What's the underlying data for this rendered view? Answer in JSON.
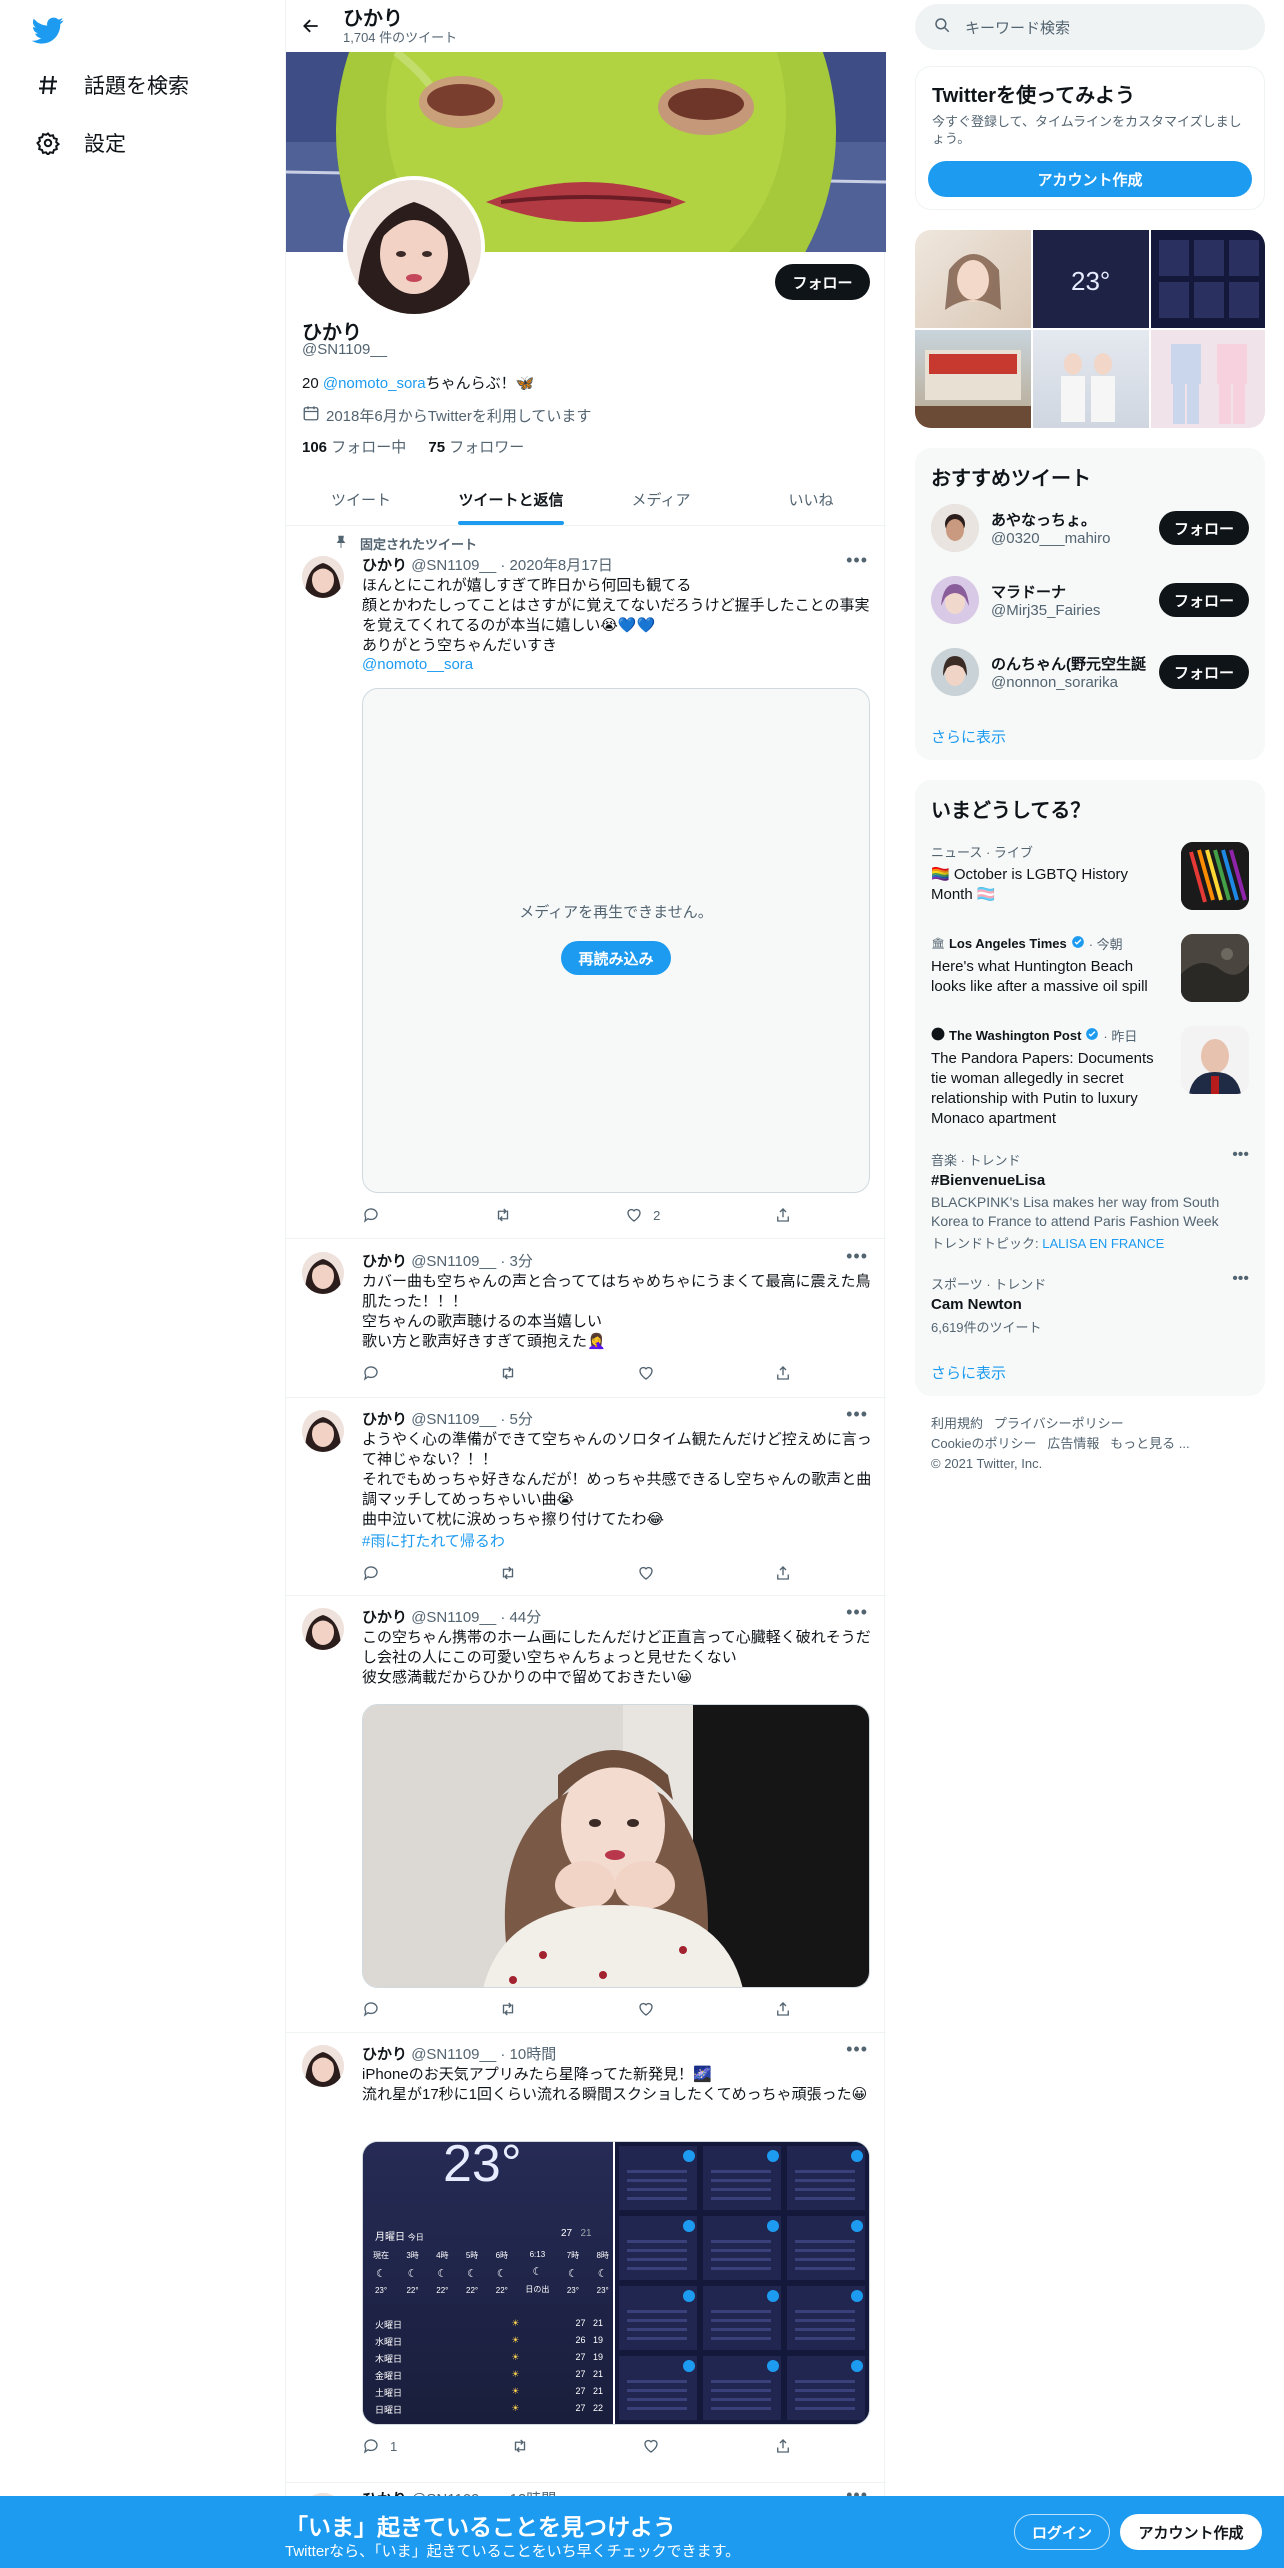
{
  "nav": {
    "explore": "話題を検索",
    "settings": "設定"
  },
  "header": {
    "name": "ひかり",
    "tweet_count": "1,704 件のツイート"
  },
  "profile": {
    "follow_label": "フォロー",
    "name": "ひかり",
    "handle": "@SN1109__",
    "bio_prefix": "20 ",
    "bio_mention": "@nomoto_sora",
    "bio_suffix": "ちゃんらぶ！🦋",
    "joined": "2018年6月からTwitterを利用しています",
    "following_count": "106",
    "following_label": " フォロー中",
    "followers_count": "75",
    "followers_label": " フォロワー"
  },
  "tabs": [
    {
      "label": "ツイート"
    },
    {
      "label": "ツイートと返信"
    },
    {
      "label": "メディア"
    },
    {
      "label": "いいね"
    }
  ],
  "tweets": [
    {
      "pinned_label": "固定されたツイート",
      "name": "ひかり",
      "handle": "@SN1109__",
      "time": "· 2020年8月17日",
      "text": "ほんとにこれが嬉しすぎて昨日から何回も観てる\n顔とかわたしってことはさすがに覚えてないだろうけど握手したことの事実を覚えてくれてるのが本当に嬉しい😭💙💙\nありがとう空ちゃんだいすき",
      "mention": "@nomoto__sora",
      "media_error": "メディアを再生できません。",
      "reload_label": "再読み込み",
      "like_count": "2"
    },
    {
      "name": "ひかり",
      "handle": "@SN1109__",
      "time": "· 3分",
      "text": "カバー曲も空ちゃんの声と合っててはちゃめちゃにうまくて最高に震えた鳥肌たった！！！\n空ちゃんの歌声聴けるの本当嬉しい\n歌い方と歌声好きすぎて頭抱えた🤦‍♀️"
    },
    {
      "name": "ひかり",
      "handle": "@SN1109__",
      "time": "· 5分",
      "text": "ようやく心の準備ができて空ちゃんのソロタイム観たんだけど控えめに言って神じゃない？！！\nそれでもめっちゃ好きなんだが！めっちゃ共感できるし空ちゃんの歌声と曲調マッチしてめっちゃいい曲😭\n曲中泣いて枕に涙めっちゃ擦り付けてたわ😂",
      "hashtag": "#雨に打たれて帰るわ"
    },
    {
      "name": "ひかり",
      "handle": "@SN1109__",
      "time": "· 44分",
      "text": "この空ちゃん携帯のホーム画にしたんだけど正直言って心臓軽く破れそうだし会社の人にこの可愛い空ちゃんちょっと見せたくない\n彼女感満載だからひかりの中で留めておきたい😀"
    },
    {
      "name": "ひかり",
      "handle": "@SN1109__",
      "time": "· 10時間",
      "text": "iPhoneのお天気アプリみたら星降ってた新発見！🌌\n流れ星が17秒に1回くらい流れる瞬間スクショしたくてめっちゃ頑張った😀",
      "reply_count": "1",
      "weather": {
        "temp": "23°",
        "day_label": "月曜日",
        "today_label": "今日",
        "hi": "27",
        "lo": "21",
        "hours": [
          "現在",
          "3時",
          "4時",
          "5時",
          "6時",
          "6:13",
          "7時",
          "8時"
        ],
        "hour_temps": [
          "23°",
          "22°",
          "22°",
          "22°",
          "22°",
          "日の出",
          "23°",
          "23°"
        ],
        "days": [
          {
            "d": "火曜日",
            "hi": "27",
            "lo": "21"
          },
          {
            "d": "水曜日",
            "hi": "26",
            "lo": "19"
          },
          {
            "d": "木曜日",
            "hi": "27",
            "lo": "19"
          },
          {
            "d": "金曜日",
            "hi": "27",
            "lo": "21"
          },
          {
            "d": "土曜日",
            "hi": "27",
            "lo": "21"
          },
          {
            "d": "日曜日",
            "hi": "27",
            "lo": "22"
          }
        ]
      }
    },
    {
      "name": "ひかり",
      "handle": "@SN1109__",
      "time": "· 12時間"
    }
  ],
  "sidebar": {
    "search_placeholder": "キーワード検索",
    "signup_title": "Twitterを使ってみよう",
    "signup_text": "今すぐ登録して、タイムラインをカスタマイズしましょう。",
    "signup_button": "アカウント作成",
    "grid_weather_temp": "23°",
    "rec_title": "おすすめツイート",
    "recommendations": [
      {
        "name": "あやなっちょ。",
        "handle": "@0320___mahiro",
        "follow": "フォロー"
      },
      {
        "name": "マラドーナ",
        "handle": "@Mirj35_Fairies",
        "follow": "フォロー"
      },
      {
        "name": "のんちゃん(野元空生誕",
        "handle": "@nonnon_sorarika",
        "follow": "フォロー"
      }
    ],
    "show_more": "さらに表示",
    "trends_title": "いまどうしてる？",
    "trends": [
      {
        "meta": "ニュース · ライブ",
        "title": "🏳️‍🌈 October is LGBTQ History Month 🏳️‍⚧️"
      },
      {
        "source": "Los Angeles Times",
        "meta": "· 今朝",
        "title": "Here's what Huntington Beach looks like after a massive oil spill"
      },
      {
        "source": "The Washington Post",
        "meta": "· 昨日",
        "title": "The Pandora Papers: Documents tie woman allegedly in secret relationship with Putin to luxury Monaco apartment"
      },
      {
        "meta": "音楽 · トレンド",
        "title": "#BienvenueLisa",
        "desc": "BLACKPINK's Lisa makes her way from South Korea to France to attend Paris Fashion Week",
        "topic_label": "トレンドトピック: ",
        "topic": "LALISA EN FRANCE"
      },
      {
        "meta": "スポーツ · トレンド",
        "title": "Cam Newton",
        "desc": "6,619件のツイート"
      }
    ],
    "trends_more": "さらに表示",
    "footer": {
      "terms": "利用規約",
      "privacy": "プライバシーポリシー",
      "cookies": "Cookieのポリシー",
      "ads": "広告情報",
      "more": "もっと見る ...",
      "copyright": "© 2021 Twitter, Inc."
    }
  },
  "bottom": {
    "title": "「いま」起きていることを見つけよう",
    "subtitle": "Twitterなら、「いま」起きていることをいち早くチェックできます。",
    "login": "ログイン",
    "signup": "アカウント作成"
  },
  "colors": {
    "accent": "#1d9bf0",
    "text": "#0f1419",
    "muted": "#536471",
    "border": "#eff3f4"
  }
}
